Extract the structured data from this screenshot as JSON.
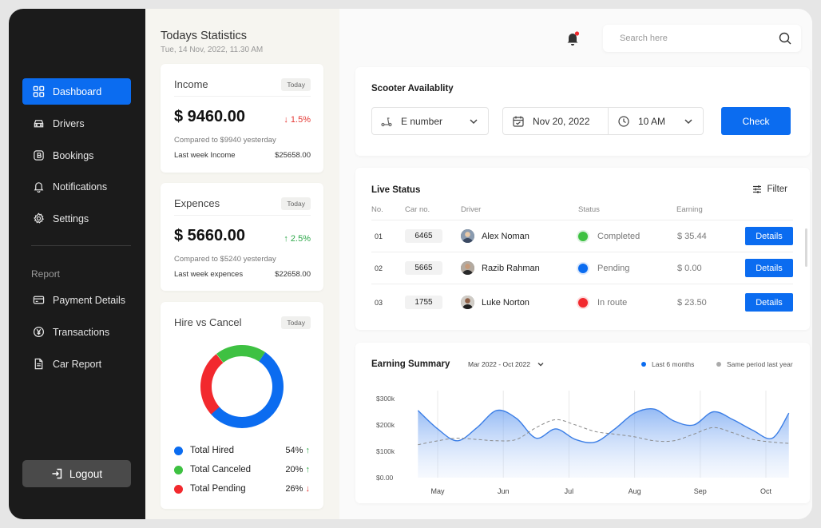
{
  "sidebar": {
    "items": [
      {
        "label": "Dashboard",
        "icon": "grid-icon",
        "active": true
      },
      {
        "label": "Drivers",
        "icon": "car-icon"
      },
      {
        "label": "Bookings",
        "icon": "bookings-icon"
      },
      {
        "label": "Notifications",
        "icon": "bell-icon"
      },
      {
        "label": "Settings",
        "icon": "gear-icon"
      }
    ],
    "report_label": "Report",
    "report_items": [
      {
        "label": "Payment Details",
        "icon": "card-icon"
      },
      {
        "label": "Transactions",
        "icon": "yen-icon"
      },
      {
        "label": "Car Report",
        "icon": "document-icon"
      }
    ],
    "logout_label": "Logout"
  },
  "stats": {
    "title": "Todays Statistics",
    "date": "Tue, 14 Nov, 2022, 11.30 AM",
    "income": {
      "label": "Income",
      "badge": "Today",
      "amount": "$ 9460.00",
      "change": "1.5%",
      "change_direction": "down",
      "compared": "Compared to $9940 yesterday",
      "last_week_label": "Last week Income",
      "last_week_value": "$25658.00"
    },
    "expences": {
      "label": "Expences",
      "badge": "Today",
      "amount": "$ 5660.00",
      "change": "2.5%",
      "change_direction": "up",
      "compared": "Compared to $5240 yesterday",
      "last_week_label": "Last week expences",
      "last_week_value": "$22658.00"
    },
    "hire_vs_cancel": {
      "label": "Hire vs Cancel",
      "badge": "Today",
      "segments": [
        {
          "label": "Total Hired",
          "value": "54%",
          "pct": 54,
          "color": "#0b6cf0",
          "arrow": "up"
        },
        {
          "label": "Total Canceled",
          "value": "20%",
          "pct": 20,
          "color": "#3ec142",
          "arrow": "up"
        },
        {
          "label": "Total Pending",
          "value": "26%",
          "pct": 26,
          "color": "#f2292e",
          "arrow": "down"
        }
      ]
    }
  },
  "header": {
    "search_placeholder": "Search here"
  },
  "availability": {
    "title": "Scooter Availablity",
    "e_number": "E number",
    "date": "Nov 20, 2022",
    "time": "10 AM",
    "check_label": "Check"
  },
  "live_status": {
    "title": "Live Status",
    "filter_label": "Filter",
    "columns": [
      "No.",
      "Car no.",
      "Driver",
      "Status",
      "Earning"
    ],
    "rows": [
      {
        "no": "01",
        "car": "6465",
        "driver": "Alex Noman",
        "status": "Completed",
        "status_color": "#3ec142",
        "earning": "$ 35.44",
        "action": "Details"
      },
      {
        "no": "02",
        "car": "5665",
        "driver": "Razib Rahman",
        "status": "Pending",
        "status_color": "#0b6cf0",
        "earning": "$ 0.00",
        "action": "Details"
      },
      {
        "no": "03",
        "car": "1755",
        "driver": "Luke Norton",
        "status": "In route",
        "status_color": "#f2292e",
        "earning": "$ 23.50",
        "action": "Details"
      }
    ]
  },
  "earning_summary": {
    "title": "Earning Summary",
    "range": "Mar 2022 - Oct 2022",
    "legend": [
      {
        "label": "Last 6 months",
        "color": "#0b6cf0"
      },
      {
        "label": "Same period last year",
        "color": "#aaaaaa"
      }
    ]
  },
  "chart_data": {
    "type": "area",
    "categories": [
      "May",
      "Jun",
      "Jul",
      "Aug",
      "Sep",
      "Oct"
    ],
    "y_ticks": [
      "$300k",
      "$200k",
      "$100k",
      "$0.00"
    ],
    "ylim": [
      0,
      300
    ],
    "series": [
      {
        "name": "Last 6 months",
        "x": [
          4.7,
          5.0,
          5.3,
          5.6,
          5.9,
          6.2,
          6.5,
          6.8,
          7.1,
          7.4,
          7.7,
          8.0,
          8.3,
          8.6,
          8.9,
          9.2,
          9.5,
          9.8,
          10.1,
          10.35
        ],
        "values": [
          255,
          185,
          140,
          190,
          255,
          225,
          150,
          185,
          145,
          135,
          185,
          245,
          260,
          215,
          200,
          250,
          220,
          180,
          150,
          245
        ]
      },
      {
        "name": "Same period last year",
        "x": [
          4.7,
          5.0,
          5.3,
          5.6,
          5.9,
          6.2,
          6.5,
          6.8,
          7.1,
          7.4,
          7.7,
          8.0,
          8.3,
          8.6,
          8.9,
          9.2,
          9.5,
          9.8,
          10.1,
          10.35
        ],
        "values": [
          125,
          140,
          150,
          145,
          140,
          145,
          190,
          220,
          200,
          175,
          165,
          155,
          140,
          140,
          165,
          190,
          170,
          145,
          135,
          130
        ]
      }
    ]
  }
}
